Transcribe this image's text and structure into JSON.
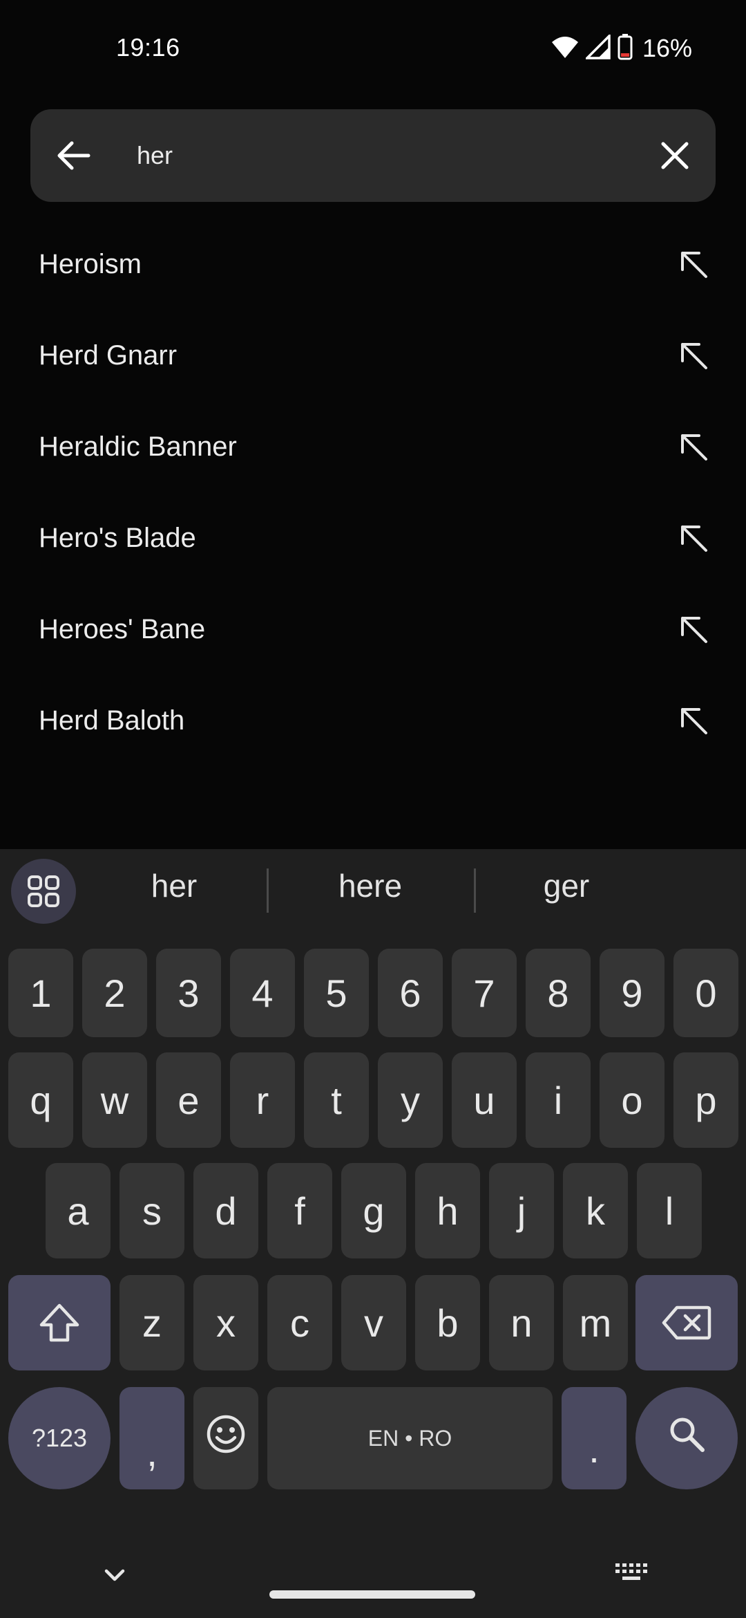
{
  "status_bar": {
    "time": "19:16",
    "battery_percent": "16%",
    "icons": [
      "wifi-icon",
      "cell-signal-icon",
      "battery-low-icon"
    ]
  },
  "search": {
    "query": "her",
    "back_icon": "arrow-back-icon",
    "clear_icon": "close-icon"
  },
  "suggestions": [
    {
      "label": "Heroism"
    },
    {
      "label": "Herd Gnarr"
    },
    {
      "label": "Heraldic Banner"
    },
    {
      "label": "Hero's Blade"
    },
    {
      "label": "Heroes' Bane"
    },
    {
      "label": "Herd Baloth"
    }
  ],
  "keyboard": {
    "word_suggestions": [
      "her",
      "here",
      "ger"
    ],
    "number_row": [
      "1",
      "2",
      "3",
      "4",
      "5",
      "6",
      "7",
      "8",
      "9",
      "0"
    ],
    "row1": [
      "q",
      "w",
      "e",
      "r",
      "t",
      "y",
      "u",
      "i",
      "o",
      "p"
    ],
    "row2": [
      "a",
      "s",
      "d",
      "f",
      "g",
      "h",
      "j",
      "k",
      "l"
    ],
    "row3": [
      "z",
      "x",
      "c",
      "v",
      "b",
      "n",
      "m"
    ],
    "symbols_key": "?123",
    "comma_key": ",",
    "period_key": ".",
    "space_label": "EN • RO",
    "accent_color": "#4a4960"
  }
}
